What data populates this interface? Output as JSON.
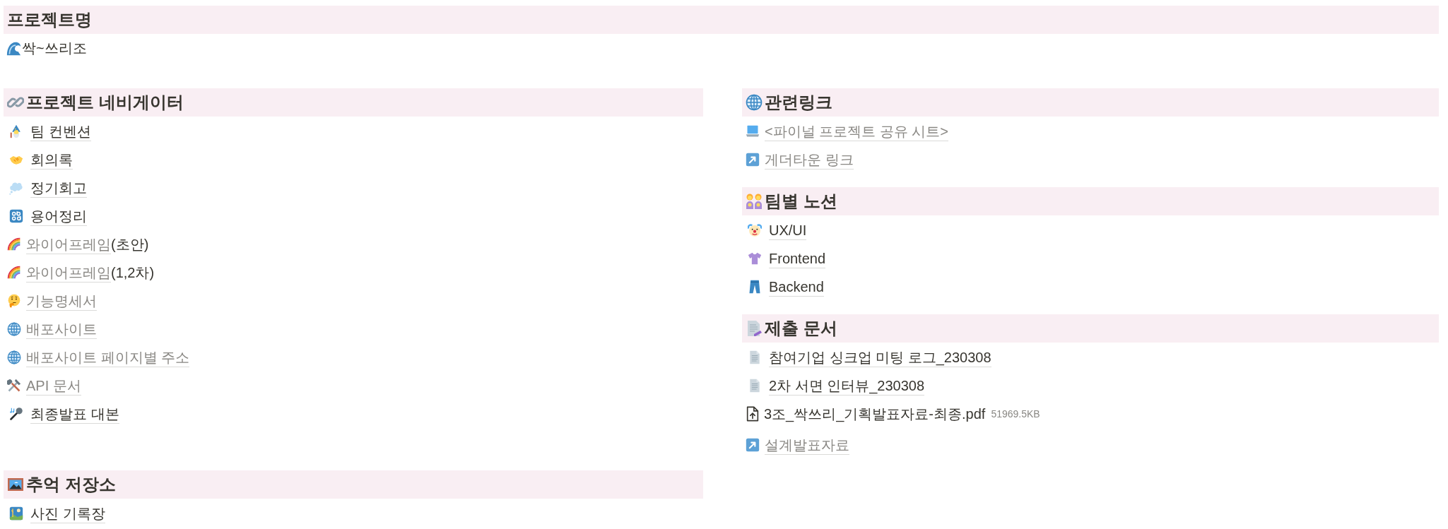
{
  "project_name": {
    "heading": "프로젝트명",
    "value": "싹~쓰리조"
  },
  "left_column": [
    {
      "heading": "프로젝트 네비게이터",
      "items": [
        {
          "kind": "page",
          "text": "팀 컨벤션"
        },
        {
          "kind": "page",
          "text": "회의록"
        },
        {
          "kind": "page",
          "text": "정기회고"
        },
        {
          "kind": "page",
          "text": "용어정리"
        },
        {
          "kind": "link",
          "text": "와이어프레임",
          "suffix": "(초안)"
        },
        {
          "kind": "link",
          "text": "와이어프레임",
          "suffix": "(1,2차)"
        },
        {
          "kind": "link",
          "text": "기능명세서"
        },
        {
          "kind": "link",
          "text": "배포사이트"
        },
        {
          "kind": "link",
          "text": "배포사이트 페이지별 주소"
        },
        {
          "kind": "link",
          "text": "API 문서"
        },
        {
          "kind": "page",
          "text": "최종발표 대본"
        }
      ]
    },
    {
      "heading": "추억 저장소",
      "items": [
        {
          "kind": "page",
          "text": "사진 기록장"
        }
      ]
    }
  ],
  "right_column": [
    {
      "heading": "관련링크",
      "items": [
        {
          "kind": "link",
          "text": "<파이널 프로젝트 공유 시트>"
        },
        {
          "kind": "link",
          "text": "게더타운 링크"
        }
      ]
    },
    {
      "heading": "팀별 노션",
      "items": [
        {
          "kind": "page",
          "text": "UX/UI"
        },
        {
          "kind": "page",
          "text": "Frontend"
        },
        {
          "kind": "page",
          "text": "Backend"
        }
      ]
    },
    {
      "heading": "제출 문서",
      "items": [
        {
          "kind": "page",
          "text": "참여기업 싱크업 미팅 로그_230308"
        },
        {
          "kind": "page",
          "text": "2차 서면 인터뷰_230308"
        },
        {
          "kind": "file",
          "text": "3조_싹쓰리_기획발표자료-최종.pdf",
          "size": "51969.5KB"
        },
        {
          "kind": "link",
          "text": "설계발표자료"
        }
      ]
    }
  ]
}
